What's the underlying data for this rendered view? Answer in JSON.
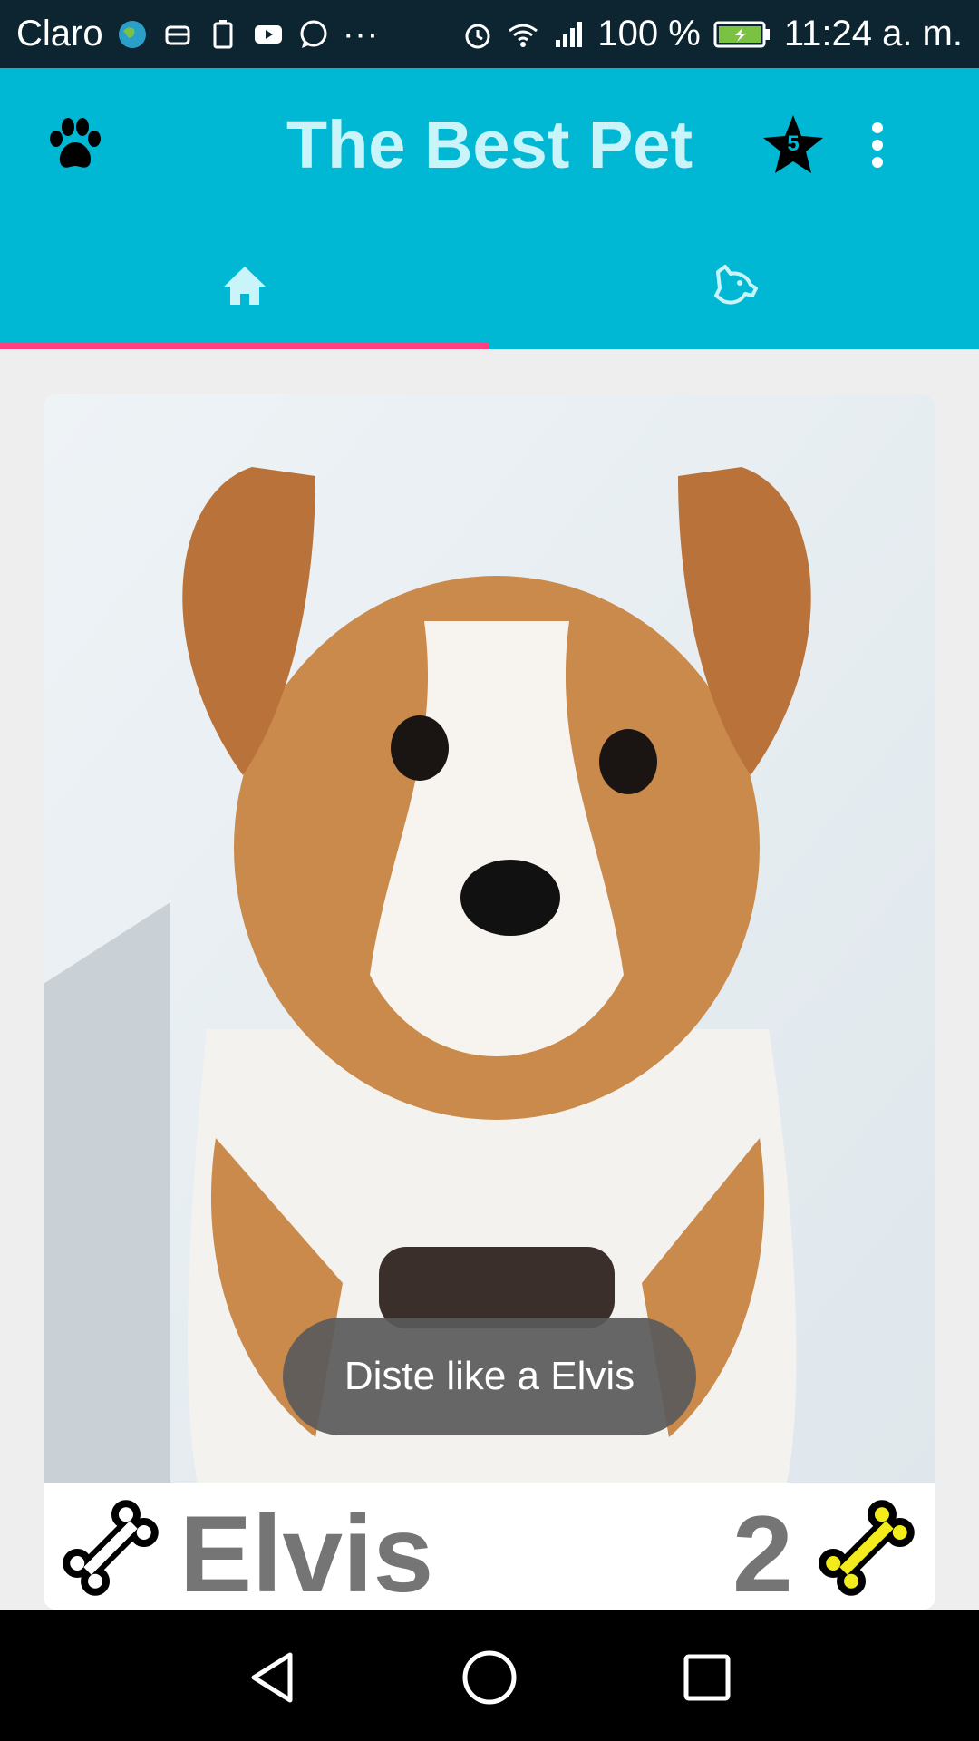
{
  "status_bar": {
    "carrier": "Claro",
    "overflow": "···",
    "battery_percent": "100 %",
    "time": "11:24 a. m.",
    "icons": [
      "globe-icon",
      "android-icon",
      "battery-alert-icon",
      "youtube-icon",
      "whatsapp-icon",
      "alarm-icon",
      "wifi-icon",
      "signal-icon",
      "battery-icon"
    ]
  },
  "app_bar": {
    "title": "The Best Pet",
    "favorites_count": "5",
    "colors": {
      "primary": "#00b8d4",
      "accent": "#ff4081",
      "title": "#c9f4f9"
    }
  },
  "tabs": [
    {
      "name": "home",
      "icon": "home-icon",
      "selected": true
    },
    {
      "name": "pet-profile",
      "icon": "dog-head-icon",
      "selected": false
    }
  ],
  "card": {
    "pet_name": "Elvis",
    "likes": "2",
    "image": "puppy-photo"
  },
  "toast": {
    "message": "Diste like a Elvis"
  },
  "nav_bar": {
    "buttons": [
      "back-icon",
      "home-circle-icon",
      "recents-icon"
    ]
  }
}
